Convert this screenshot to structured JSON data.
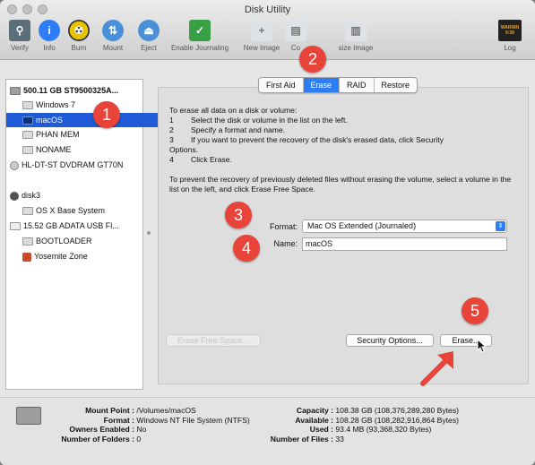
{
  "window": {
    "title": "Disk Utility"
  },
  "toolbar": {
    "items": [
      {
        "label": "Verify",
        "icon": "microscope-icon",
        "color": "#5b6f7a"
      },
      {
        "label": "Info",
        "icon": "info-icon",
        "color": "#2f7df5"
      },
      {
        "label": "Burn",
        "icon": "burn-icon",
        "color": "#c9a400"
      },
      {
        "label": "Mount",
        "icon": "mount-icon",
        "color": "#4a90d9"
      },
      {
        "label": "Eject",
        "icon": "eject-icon",
        "color": "#4a90d9"
      },
      {
        "label": "Enable Journaling",
        "icon": "journaling-icon",
        "color": "#3aa045"
      },
      {
        "label": "New Image",
        "icon": "new-image-icon",
        "color": "#9aa0a6"
      },
      {
        "label": "Co",
        "icon": "convert-icon",
        "color": "#9aa0a6"
      },
      {
        "label": "size Image",
        "icon": "resize-image-icon",
        "color": "#9aa0a6"
      },
      {
        "label": "Log",
        "icon": "log-icon",
        "color": "#333333",
        "badge": "WARNIN\n9:36"
      }
    ]
  },
  "sidebar": {
    "items": [
      {
        "label": "500.11 GB ST9500325A...",
        "kind": "hdd"
      },
      {
        "label": "Windows 7",
        "kind": "vol"
      },
      {
        "label": "macOS",
        "kind": "vol",
        "selected": true
      },
      {
        "label": "PHAN MEM",
        "kind": "vol"
      },
      {
        "label": "NONAME",
        "kind": "vol"
      },
      {
        "label": "HL-DT-ST DVDRAM GT70N",
        "kind": "dvd"
      },
      {
        "label": "disk3",
        "kind": "disk"
      },
      {
        "label": "OS X Base System",
        "kind": "vol"
      },
      {
        "label": "15.52 GB ADATA USB Fl...",
        "kind": "usb"
      },
      {
        "label": "BOOTLOADER",
        "kind": "vol"
      },
      {
        "label": "Yosemite Zone",
        "kind": "yosemite"
      }
    ]
  },
  "tabs": [
    "First Aid",
    "Erase",
    "RAID",
    "Restore"
  ],
  "active_tab": "Erase",
  "erase": {
    "instructions_heading": "To erase all data on a disk or volume:",
    "steps": [
      {
        "num": "1",
        "text": "Select the disk or volume in the list on the left."
      },
      {
        "num": "2",
        "text": "Specify a format and name."
      },
      {
        "num": "3",
        "text": "If you want to prevent the recovery of the disk's erased data, click Security"
      }
    ],
    "step3_cont": "Options.",
    "step4": {
      "num": "4",
      "text": "Click Erase."
    },
    "free_space_note": "To prevent the recovery of previously deleted files without erasing the volume, select a volume in the list on the left, and click Erase Free Space.",
    "format_label": "Format:",
    "format_value": "Mac OS Extended (Journaled)",
    "name_label": "Name:",
    "name_value": "macOS",
    "erase_free_space_button": "Erase Free Space...",
    "security_options_button": "Security Options...",
    "erase_button": "Erase..."
  },
  "annotations": {
    "badges": [
      "1",
      "2",
      "3",
      "4",
      "5"
    ],
    "color": "#e8443a"
  },
  "info": {
    "left": [
      {
        "key": "Mount Point :",
        "value": "/Volumes/macOS"
      },
      {
        "key": "Format :",
        "value": "Windows NT File System (NTFS)"
      },
      {
        "key": "Owners Enabled :",
        "value": "No"
      },
      {
        "key": "Number of Folders :",
        "value": "0"
      }
    ],
    "right": [
      {
        "key": "Capacity :",
        "value": "108.38 GB (108,376,289,280 Bytes)"
      },
      {
        "key": "Available :",
        "value": "108.28 GB (108,282,916,864 Bytes)"
      },
      {
        "key": "Used :",
        "value": "93.4 MB (93,368,320 Bytes)"
      },
      {
        "key": "Number of Files :",
        "value": "33"
      }
    ]
  }
}
